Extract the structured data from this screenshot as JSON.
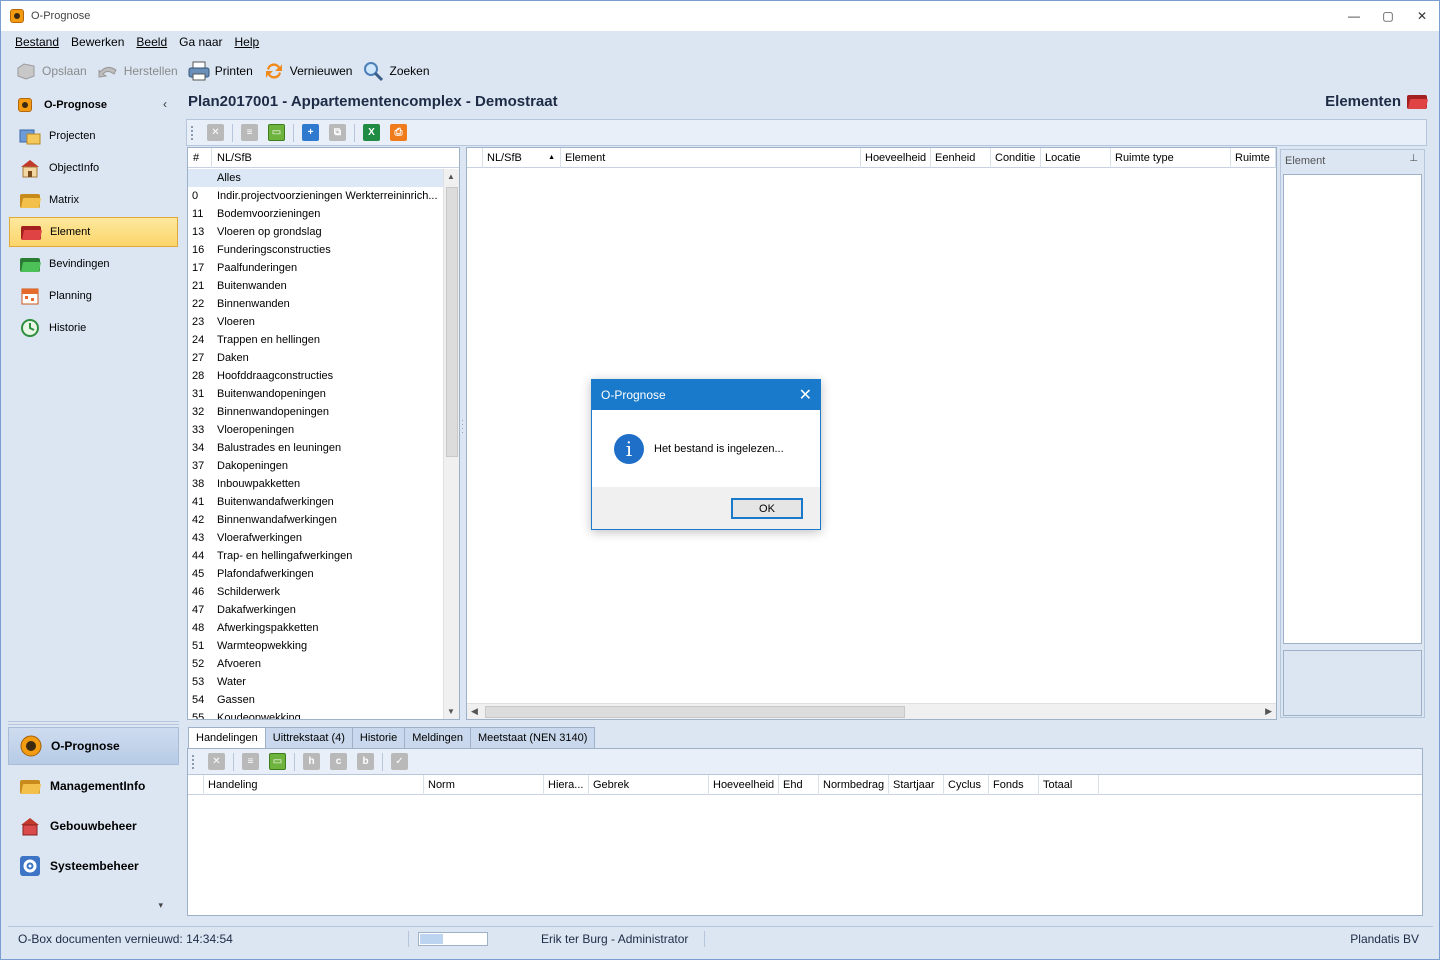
{
  "window": {
    "title": "O-Prognose",
    "minimize": "—",
    "maximize": "▢",
    "close": "✕"
  },
  "menu": {
    "items": [
      "Bestand",
      "Bewerken",
      "Beeld",
      "Ga naar",
      "Help"
    ]
  },
  "toolbar": {
    "save_label": "Opslaan",
    "restore_label": "Herstellen",
    "print_label": "Printen",
    "refresh_label": "Vernieuwen",
    "search_label": "Zoeken"
  },
  "nav": {
    "header": "O-Prognose",
    "collapse": "‹",
    "items": [
      {
        "label": "Projecten",
        "color": "#4d7fc9"
      },
      {
        "label": "ObjectInfo",
        "color": "#c0392b"
      },
      {
        "label": "Matrix",
        "color": "#e5a21b"
      },
      {
        "label": "Element",
        "color": "#d62b2b"
      },
      {
        "label": "Bevindingen",
        "color": "#3aa24a"
      },
      {
        "label": "Planning",
        "color": "#e46b2b"
      },
      {
        "label": "Historie",
        "color": "#2f8f3f"
      }
    ],
    "modules": [
      "O-Prognose",
      "ManagementInfo",
      "Gebouwbeheer",
      "Systeembeheer"
    ],
    "more": "▾"
  },
  "main": {
    "title": "Plan2017001 - Appartementencomplex - Demostraat",
    "badge": "Elementen"
  },
  "list": {
    "col_num": "#",
    "col_name": "NL/SfB",
    "rows": [
      {
        "num": "",
        "name": "Alles"
      },
      {
        "num": "0",
        "name": "Indir.projectvoorzieningen Werkterreininrich..."
      },
      {
        "num": "11",
        "name": "Bodemvoorzieningen"
      },
      {
        "num": "13",
        "name": "Vloeren op grondslag"
      },
      {
        "num": "16",
        "name": "Funderingsconstructies"
      },
      {
        "num": "17",
        "name": "Paalfunderingen"
      },
      {
        "num": "21",
        "name": "Buitenwanden"
      },
      {
        "num": "22",
        "name": "Binnenwanden"
      },
      {
        "num": "23",
        "name": "Vloeren"
      },
      {
        "num": "24",
        "name": "Trappen en hellingen"
      },
      {
        "num": "27",
        "name": "Daken"
      },
      {
        "num": "28",
        "name": "Hoofddraagconstructies"
      },
      {
        "num": "31",
        "name": "Buitenwandopeningen"
      },
      {
        "num": "32",
        "name": "Binnenwandopeningen"
      },
      {
        "num": "33",
        "name": "Vloeropeningen"
      },
      {
        "num": "34",
        "name": "Balustrades en leuningen"
      },
      {
        "num": "37",
        "name": "Dakopeningen"
      },
      {
        "num": "38",
        "name": "Inbouwpakketten"
      },
      {
        "num": "41",
        "name": "Buitenwandafwerkingen"
      },
      {
        "num": "42",
        "name": "Binnenwandafwerkingen"
      },
      {
        "num": "43",
        "name": "Vloerafwerkingen"
      },
      {
        "num": "44",
        "name": "Trap- en hellingafwerkingen"
      },
      {
        "num": "45",
        "name": "Plafondafwerkingen"
      },
      {
        "num": "46",
        "name": "Schilderwerk"
      },
      {
        "num": "47",
        "name": "Dakafwerkingen"
      },
      {
        "num": "48",
        "name": "Afwerkingspakketten"
      },
      {
        "num": "51",
        "name": "Warmteopwekking"
      },
      {
        "num": "52",
        "name": "Afvoeren"
      },
      {
        "num": "53",
        "name": "Water"
      },
      {
        "num": "54",
        "name": "Gassen"
      },
      {
        "num": "55",
        "name": "Koudeopwekking"
      }
    ]
  },
  "grid": {
    "columns": [
      "",
      "NL/SfB",
      "Element",
      "Hoeveelheid",
      "Eenheid",
      "Conditie",
      "Locatie",
      "Ruimte type",
      "Ruimte"
    ],
    "sort_indicator": "▲"
  },
  "right_panel": {
    "title": "Element",
    "pin": "⊥"
  },
  "bottom": {
    "tabs": [
      "Handelingen",
      "Uittrekstaat (4)",
      "Historie",
      "Meldingen",
      "Meetstaat (NEN 3140)"
    ],
    "tool_labels": [
      "h",
      "c",
      "b"
    ],
    "columns": [
      "",
      "Handeling",
      "Norm",
      "Hiera...",
      "Gebrek",
      "Hoeveelheid",
      "Ehd",
      "Normbedrag",
      "Startjaar",
      "Cyclus",
      "Fonds",
      "Totaal"
    ]
  },
  "status": {
    "left": "O-Box documenten vernieuwd: 14:34:54",
    "progress": 0.35,
    "user": "Erik ter Burg - Administrator",
    "company": "Plandatis BV"
  },
  "dialog": {
    "title": "O-Prognose",
    "message": "Het bestand is ingelezen...",
    "ok": "OK",
    "close": "✕",
    "info_glyph": "i"
  }
}
